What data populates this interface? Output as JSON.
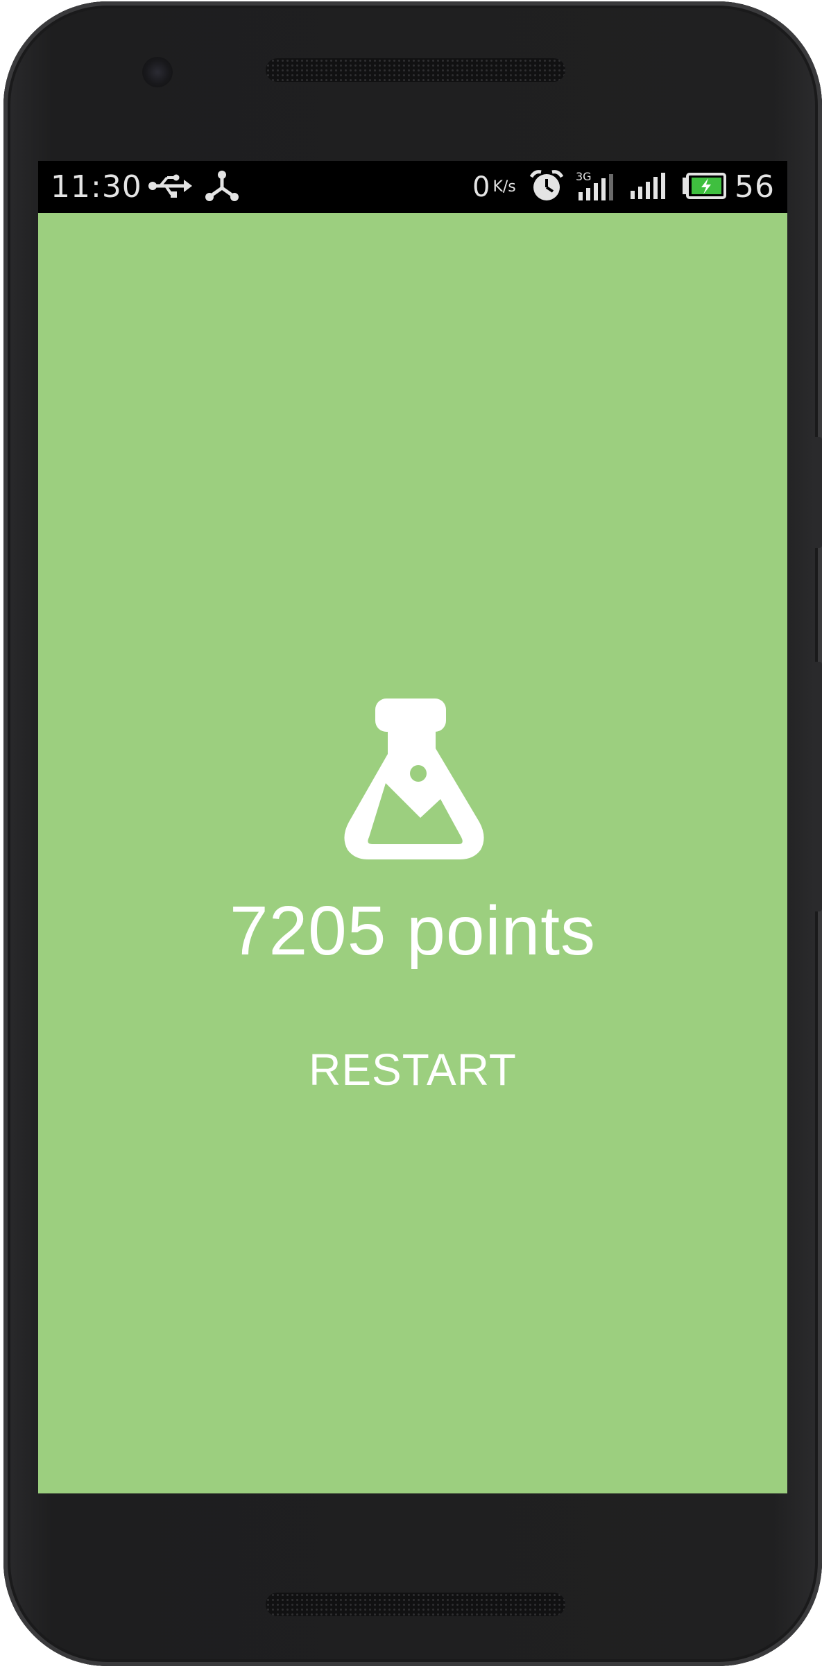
{
  "statusbar": {
    "time": "11:30",
    "net_speed_value": "0",
    "net_speed_unit": "K/s",
    "network_type": "3G",
    "battery_level": "56",
    "icons": [
      "usb-icon",
      "share-icon",
      "alarm-clock-icon",
      "signal-3g-icon",
      "signal-icon",
      "battery-charging-icon"
    ]
  },
  "game_over": {
    "icon": "flask-icon",
    "score_label": "7205 points",
    "restart_label": "RESTART"
  },
  "colors": {
    "background": "#9ccf7f",
    "text": "#ffffff",
    "statusbar": "#000000",
    "battery_fill": "#3fbf3f"
  }
}
